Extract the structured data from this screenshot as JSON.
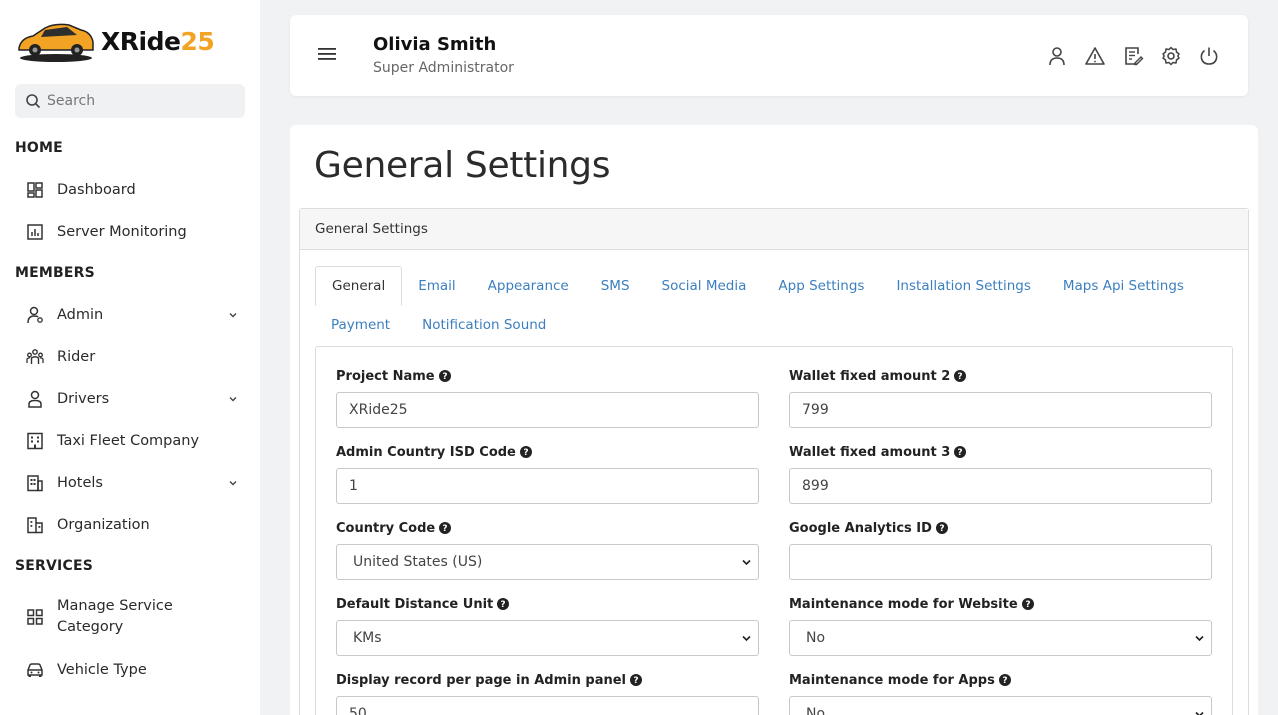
{
  "brand": {
    "logo_prefix": "XRide",
    "logo_suffix": "25",
    "accent": "#f2a324"
  },
  "search": {
    "placeholder": "Search"
  },
  "sidebar": {
    "sections": [
      {
        "title": "HOME"
      },
      {
        "title": "MEMBERS"
      },
      {
        "title": "SERVICES"
      }
    ],
    "items": [
      {
        "label": "Dashboard",
        "icon": "dashboard-icon"
      },
      {
        "label": "Server Monitoring",
        "icon": "chart-icon"
      },
      {
        "label": "Admin",
        "icon": "admin-user-icon"
      },
      {
        "label": "Rider",
        "icon": "group-icon"
      },
      {
        "label": "Drivers",
        "icon": "driver-icon"
      },
      {
        "label": "Taxi Fleet Company",
        "icon": "building-icon"
      },
      {
        "label": "Hotels",
        "icon": "hotel-icon"
      },
      {
        "label": "Organization",
        "icon": "organization-icon"
      },
      {
        "label": "Manage Service Category",
        "icon": "grid-icon"
      },
      {
        "label": "Vehicle Type",
        "icon": "car-icon"
      }
    ]
  },
  "header": {
    "user_name": "Olivia Smith",
    "user_role": "Super Administrator",
    "icons": [
      "profile-icon",
      "alert-icon",
      "edit-note-icon",
      "settings-icon",
      "power-icon"
    ]
  },
  "main": {
    "title": "General Settings",
    "card_title": "General Settings",
    "tabs": [
      {
        "label": "General",
        "active": true
      },
      {
        "label": "Email"
      },
      {
        "label": "Appearance"
      },
      {
        "label": "SMS"
      },
      {
        "label": "Social Media"
      },
      {
        "label": "App Settings"
      },
      {
        "label": "Installation Settings"
      },
      {
        "label": "Maps Api Settings"
      },
      {
        "label": "Payment"
      },
      {
        "label": "Notification Sound"
      }
    ],
    "fields": [
      {
        "label": "Project Name",
        "type": "text",
        "value": "XRide25"
      },
      {
        "label": "Wallet fixed amount 2",
        "type": "text",
        "value": "799"
      },
      {
        "label": "Admin Country ISD Code",
        "type": "text",
        "value": "1"
      },
      {
        "label": "Wallet fixed amount 3",
        "type": "text",
        "value": "899"
      },
      {
        "label": "Country Code",
        "type": "select",
        "value": "United States (US)"
      },
      {
        "label": "Google Analytics ID",
        "type": "text",
        "value": ""
      },
      {
        "label": "Default Distance Unit",
        "type": "select",
        "value": "KMs"
      },
      {
        "label": "Maintenance mode for Website",
        "type": "select",
        "value": "No"
      },
      {
        "label": "Display record per page in Admin panel",
        "type": "text",
        "value": "50"
      },
      {
        "label": "Maintenance mode for Apps",
        "type": "select",
        "value": "No"
      }
    ]
  }
}
